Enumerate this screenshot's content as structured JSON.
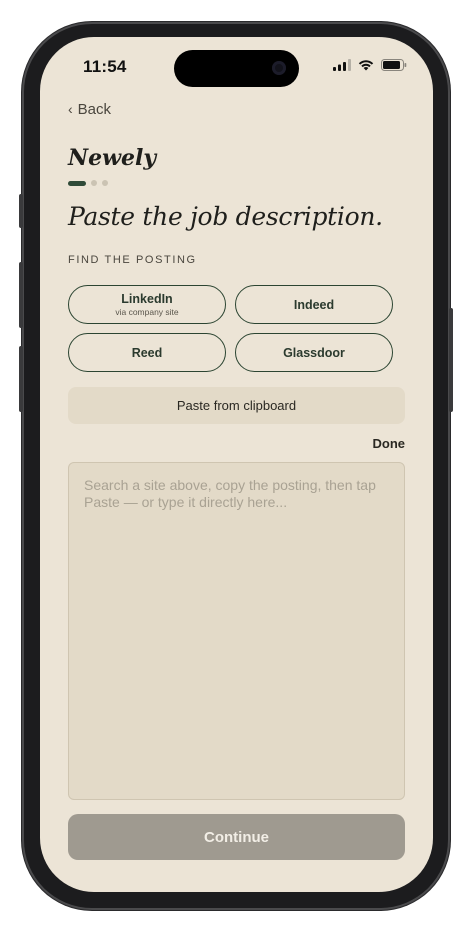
{
  "status_bar": {
    "time": "11:54",
    "icons": [
      "cellular-signal-icon",
      "wifi-icon",
      "battery-icon"
    ]
  },
  "nav": {
    "back_label": "Back"
  },
  "brand": {
    "name": "Newely"
  },
  "progress": {
    "current_step": 1,
    "total_steps": 3
  },
  "page": {
    "title": "Paste the job description.",
    "section_label": "FIND THE POSTING"
  },
  "sources": [
    {
      "name": "LinkedIn",
      "subtitle": "via company site"
    },
    {
      "name": "Indeed",
      "subtitle": ""
    },
    {
      "name": "Reed",
      "subtitle": ""
    },
    {
      "name": "Glassdoor",
      "subtitle": ""
    }
  ],
  "actions": {
    "paste_label": "Paste from clipboard",
    "done_label": "Done",
    "continue_label": "Continue"
  },
  "editor": {
    "value": "",
    "placeholder": "Search a site above, copy the posting, then tap Paste — or type it directly here..."
  },
  "colors": {
    "background": "#ece4d6",
    "accent": "#2c4532",
    "input_background": "#e3dac8",
    "continue_disabled": "#9f9a90"
  }
}
